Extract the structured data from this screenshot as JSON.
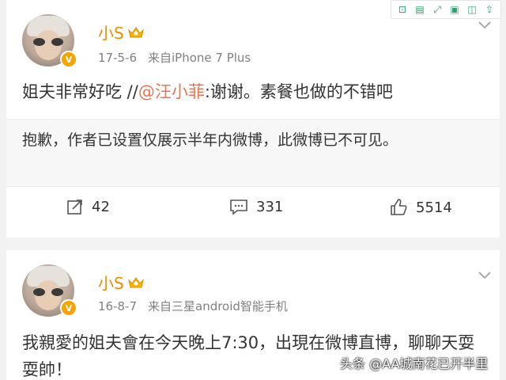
{
  "toolbar": {
    "icons": [
      "fullscreen-icon",
      "page-icon",
      "expand-icon",
      "save-icon",
      "bookmark-icon",
      "share-icon"
    ]
  },
  "posts": [
    {
      "username": "小S",
      "verified_badge": "V",
      "date": "17-5-6",
      "source": "来自iPhone 7 Plus",
      "text_main": "姐夫非常好吃 //",
      "mention": "@汪小菲",
      "text_rest": ":谢谢。素餐也做的不错吧",
      "quoted_notice": "抱歉，作者已设置仅展示半年内微博，此微博已不可见。",
      "reposts": "42",
      "comments": "331",
      "likes": "5514"
    },
    {
      "username": "小S",
      "verified_badge": "V",
      "date": "16-8-7",
      "source": "来自三星android智能手机",
      "text": "我親愛的姐夫會在今天晚上7:30，出現在微博直博，聊聊天耍耍帥！"
    }
  ],
  "watermark": "头条 @AA城南花已开半里",
  "colors": {
    "username": "#f08a00",
    "mention": "#eb7350",
    "verified": "#f7a300",
    "background": "#f2f2f2"
  }
}
